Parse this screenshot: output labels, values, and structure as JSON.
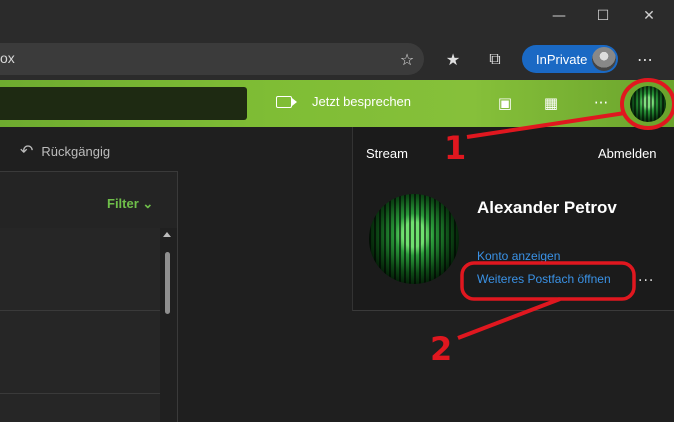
{
  "browser": {
    "address_text": "ox",
    "inprivate_label": "InPrivate",
    "window_controls": [
      "minimize-icon",
      "maximize-icon",
      "close-icon"
    ]
  },
  "outlook_header": {
    "meet_now_label": "Jetzt besprechen",
    "more_label": "···"
  },
  "toolbar": {
    "undo_label": "Rückgängig"
  },
  "mail_list": {
    "filter_label": "Filter"
  },
  "profile_panel": {
    "stream_label": "Stream",
    "logout_label": "Abmelden",
    "user_name": "Alexander Petrov",
    "view_account_label": "Konto anzeigen",
    "open_other_mailbox_label": "Weiteres Postfach öffnen",
    "more_label": "···"
  },
  "annotations": {
    "step1": "1",
    "step2": "2",
    "color": "#e0171f"
  },
  "colors": {
    "accent_green": "#7fbd35",
    "link_blue": "#3a92e6",
    "inprivate_blue": "#1a69c4"
  }
}
